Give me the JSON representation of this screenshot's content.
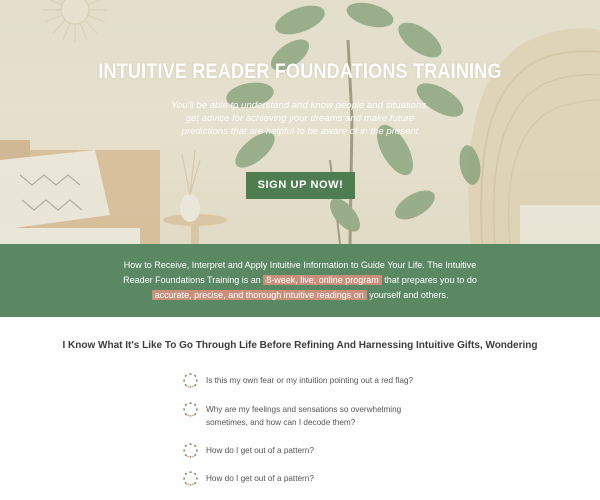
{
  "hero": {
    "title": "INTUITIVE READER FOUNDATIONS TRAINING",
    "subtitle": "You'll be able to understand and know people and situations, get advice for achieving your dreams and make future predictions that are helpful to be aware of in the present",
    "cta_label": "SIGN UP NOW!"
  },
  "intro": {
    "text_1": "How to Receive, Interpret and Apply Intuitive Information to Guide Your Life. The Intuitive Reader Foundations Training is an ",
    "highlight_1": "8-week, live, online program",
    "text_2": " that prepares you to do ",
    "highlight_2": "accurate, precise, and thorough intuitive readings on",
    "text_3": " yourself and others."
  },
  "questions_section": {
    "heading": "I Know What It's Like To Go Through Life Before Refining And Harnessing Intuitive Gifts, Wondering",
    "items": [
      "Is this my own fear or my intuition pointing out a red flag?",
      "Why are my feelings and sensations so overwhelming sometimes, and how can I decode them?",
      "How do I get out of a pattern?",
      "How do I get out of a pattern?"
    ]
  },
  "colors": {
    "accent_green": "#5a8862",
    "button_green": "#4e7d52",
    "highlight": "#c98f7a"
  },
  "icons": {
    "list_bullet": "leaf-wreath-icon"
  }
}
